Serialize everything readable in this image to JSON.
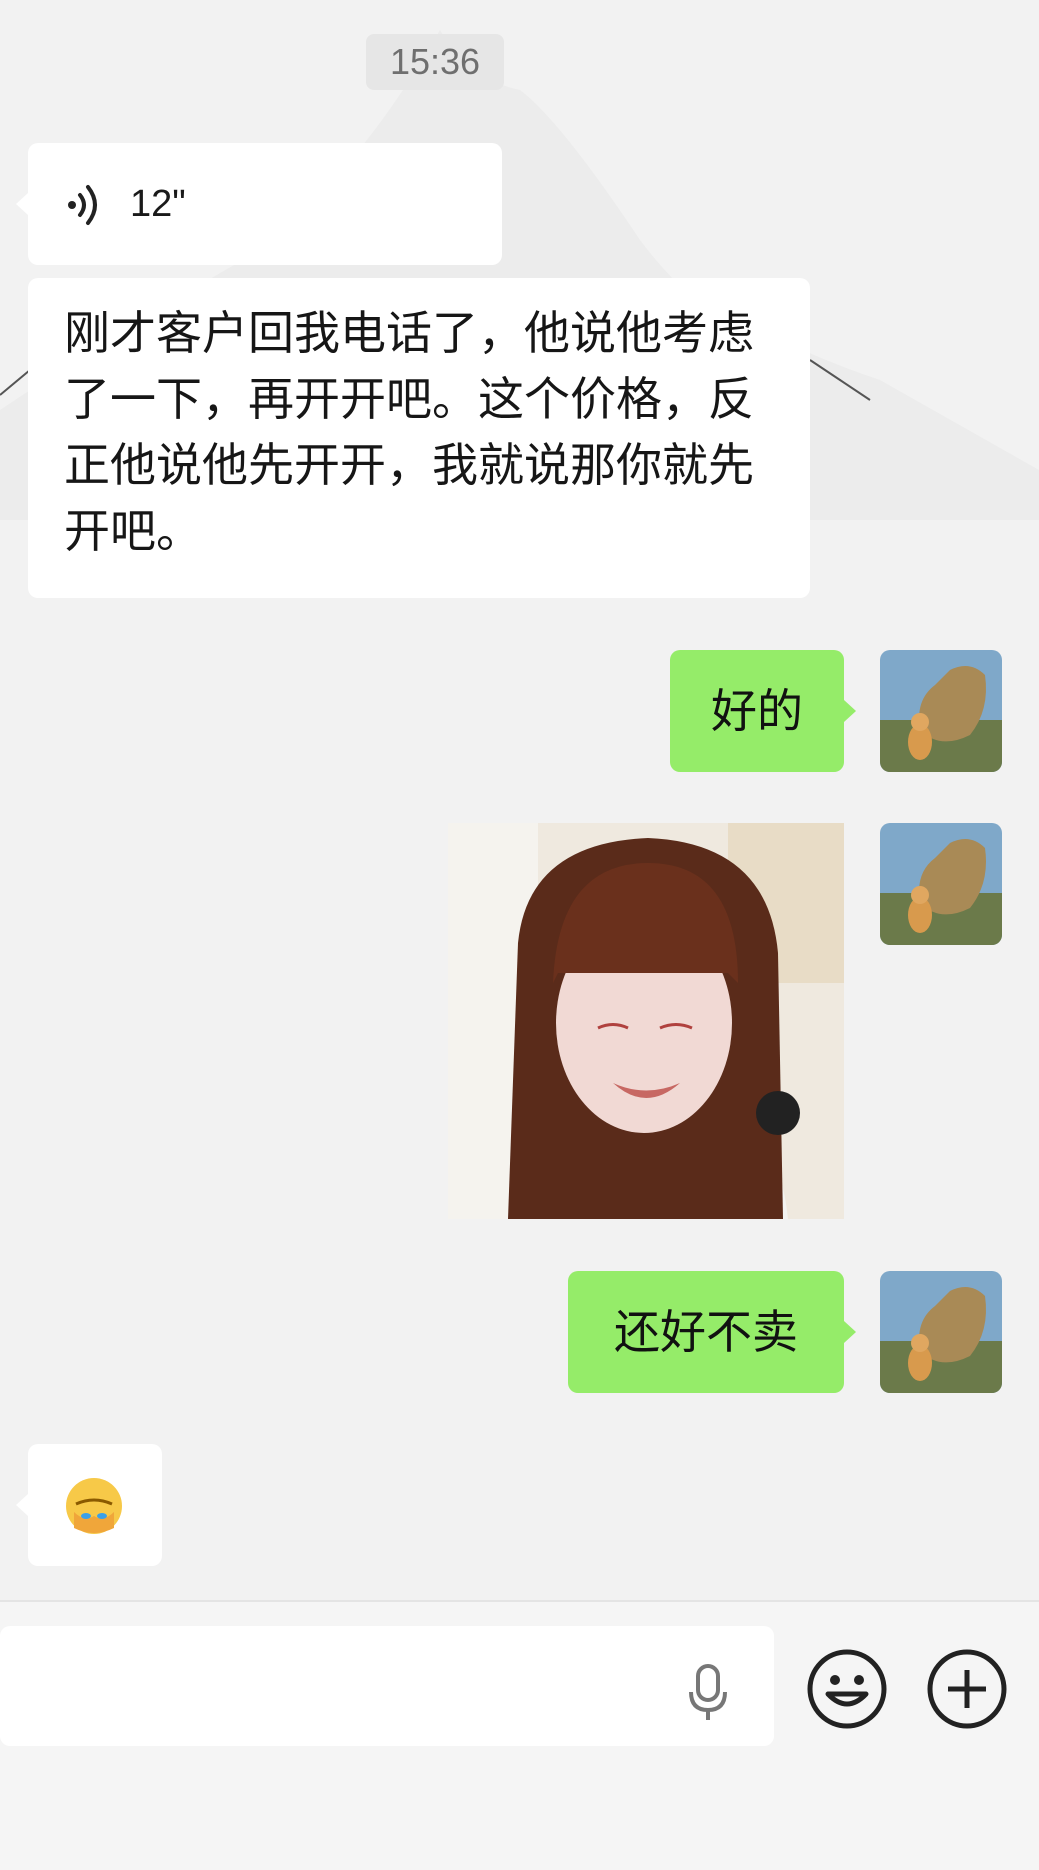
{
  "header": {
    "time": "15:36"
  },
  "messages": {
    "voice": {
      "duration": "12\""
    },
    "incoming_text": "刚才客户回我电话了，他说他考虑了一下，再开开吧。这个价格，反正他说他先开开，我就说那你就先开吧。",
    "reply_1": "好的",
    "reply_2": "还好不卖",
    "incoming_emoji": "🤦"
  },
  "composer": {
    "value": "",
    "placeholder": ""
  },
  "colors": {
    "outgoing_bubble": "#95ec69",
    "incoming_bubble": "#ffffff",
    "background": "#f2f2f2"
  },
  "icons": [
    "voice-icon",
    "microphone-icon",
    "emoji-icon",
    "plus-icon"
  ]
}
